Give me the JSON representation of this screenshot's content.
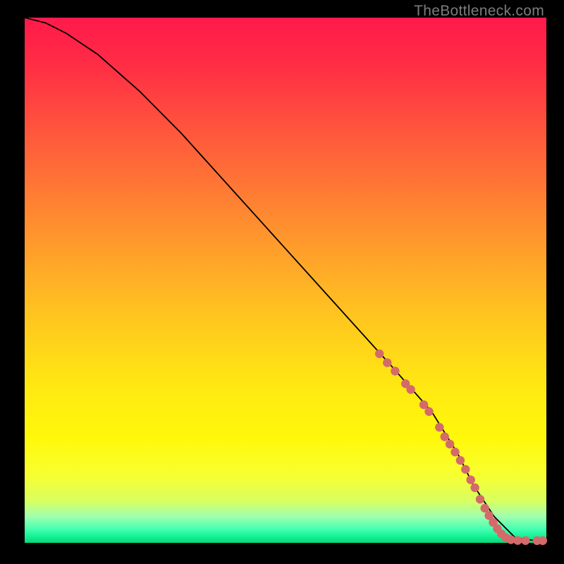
{
  "watermark": "TheBottleneck.com",
  "colors": {
    "line": "#000000",
    "dot": "#d46a6a",
    "page_bg": "#000000"
  },
  "chart_data": {
    "type": "line",
    "title": "",
    "xlabel": "",
    "ylabel": "",
    "xlim": [
      0,
      100
    ],
    "ylim": [
      0,
      100
    ],
    "x": [
      0,
      4,
      8,
      14,
      22,
      30,
      40,
      50,
      60,
      70,
      78,
      83,
      86,
      90,
      94,
      98,
      100
    ],
    "values": [
      100,
      99,
      97,
      93,
      86,
      78,
      67,
      56,
      45,
      34,
      25,
      17,
      11,
      5,
      1,
      0.4,
      0.4
    ],
    "dot_points": [
      {
        "x": 68.0,
        "y": 36.0
      },
      {
        "x": 69.5,
        "y": 34.3
      },
      {
        "x": 71.0,
        "y": 32.7
      },
      {
        "x": 73.0,
        "y": 30.3
      },
      {
        "x": 74.0,
        "y": 29.2
      },
      {
        "x": 76.5,
        "y": 26.3
      },
      {
        "x": 77.5,
        "y": 25.0
      },
      {
        "x": 79.5,
        "y": 22.0
      },
      {
        "x": 80.5,
        "y": 20.2
      },
      {
        "x": 81.5,
        "y": 18.8
      },
      {
        "x": 82.5,
        "y": 17.3
      },
      {
        "x": 83.5,
        "y": 15.7
      },
      {
        "x": 84.5,
        "y": 14.0
      },
      {
        "x": 85.5,
        "y": 12.0
      },
      {
        "x": 86.3,
        "y": 10.5
      },
      {
        "x": 87.3,
        "y": 8.3
      },
      {
        "x": 88.2,
        "y": 6.6
      },
      {
        "x": 89.0,
        "y": 5.2
      },
      {
        "x": 89.8,
        "y": 3.9
      },
      {
        "x": 90.6,
        "y": 2.7
      },
      {
        "x": 91.4,
        "y": 1.7
      },
      {
        "x": 92.2,
        "y": 1.0
      },
      {
        "x": 93.2,
        "y": 0.6
      },
      {
        "x": 94.5,
        "y": 0.45
      },
      {
        "x": 96.0,
        "y": 0.43
      },
      {
        "x": 98.2,
        "y": 0.42
      },
      {
        "x": 99.3,
        "y": 0.42
      }
    ]
  }
}
